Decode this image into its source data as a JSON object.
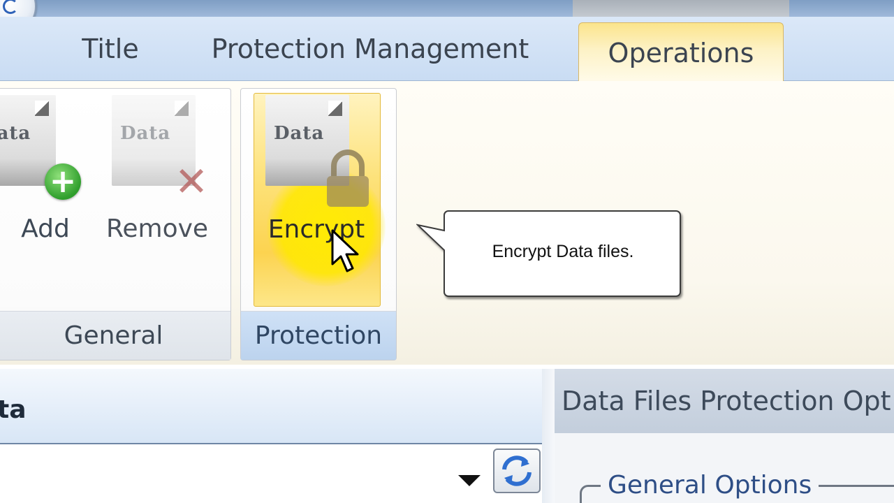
{
  "tabs": {
    "title": "Title",
    "protection_management": "Protection Management",
    "operations": "Operations"
  },
  "ribbon": {
    "groups": {
      "general": "General",
      "protection": "Protection"
    },
    "buttons": {
      "add": "Add",
      "remove": "Remove",
      "encrypt": "Encrypt"
    },
    "doc_icon_text": "Data"
  },
  "tooltip": {
    "text": "Encrypt Data files."
  },
  "lower_left": {
    "title": "ta"
  },
  "lower_right": {
    "title": "Data Files Protection Opt",
    "general_options": "General Options"
  },
  "colors": {
    "accent_selected_tab": "#fbe48c",
    "highlight": "#ffe800",
    "ribbon_tab_bar": "#c9dcf3"
  },
  "icons": {
    "add": "plus-icon",
    "remove": "x-icon",
    "encrypt": "lock-icon",
    "refresh": "refresh-icon",
    "combo": "chevron-down-icon"
  }
}
